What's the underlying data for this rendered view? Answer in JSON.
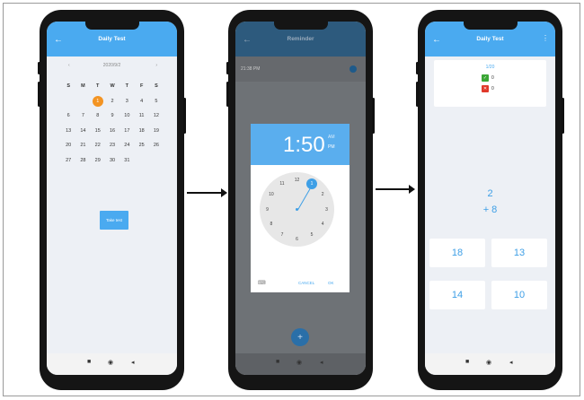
{
  "phone1": {
    "title": "Daily Test",
    "back": "←",
    "month_label": "2020/9/2",
    "prev": "‹",
    "next": "›",
    "weekdays": [
      "S",
      "M",
      "T",
      "W",
      "T",
      "F",
      "S"
    ],
    "days": [
      "",
      "",
      "1",
      "2",
      "3",
      "4",
      "5",
      "6",
      "7",
      "8",
      "9",
      "10",
      "11",
      "12",
      "13",
      "14",
      "15",
      "16",
      "17",
      "18",
      "19",
      "20",
      "21",
      "22",
      "23",
      "24",
      "25",
      "26",
      "27",
      "28",
      "29",
      "30",
      "31",
      "",
      ""
    ],
    "selected_day": "1",
    "take_test_label": "Take test",
    "nav": [
      "■",
      "◉",
      "◂"
    ]
  },
  "phone2": {
    "title": "Reminder",
    "back": "←",
    "reminder_time": "21:38 PM",
    "time_display": "1:50",
    "am": "AM",
    "pm": "PM",
    "clock_numbers": [
      "12",
      "1",
      "2",
      "3",
      "4",
      "5",
      "6",
      "7",
      "8",
      "9",
      "10",
      "11"
    ],
    "selected_hour": "1",
    "cancel_label": "CANCEL",
    "ok_label": "OK",
    "keyboard_icon": "⌨",
    "fab_icon": "+",
    "nav": [
      "■",
      "◉",
      "◂"
    ]
  },
  "phone3": {
    "title": "Daily Test",
    "back": "←",
    "menu": "⋮",
    "progress": "1/20",
    "correct_count": "0",
    "wrong_count": "0",
    "correct_icon": "✓",
    "wrong_icon": "✕",
    "operand1": "2",
    "operation": "+ 8",
    "answers": [
      "18",
      "13",
      "14",
      "10"
    ],
    "nav": [
      "■",
      "◉",
      "◂"
    ]
  },
  "colors": {
    "accent": "#4aaaf0",
    "selected_day": "#f39423",
    "correct": "#3aa635",
    "wrong": "#e0392b"
  }
}
